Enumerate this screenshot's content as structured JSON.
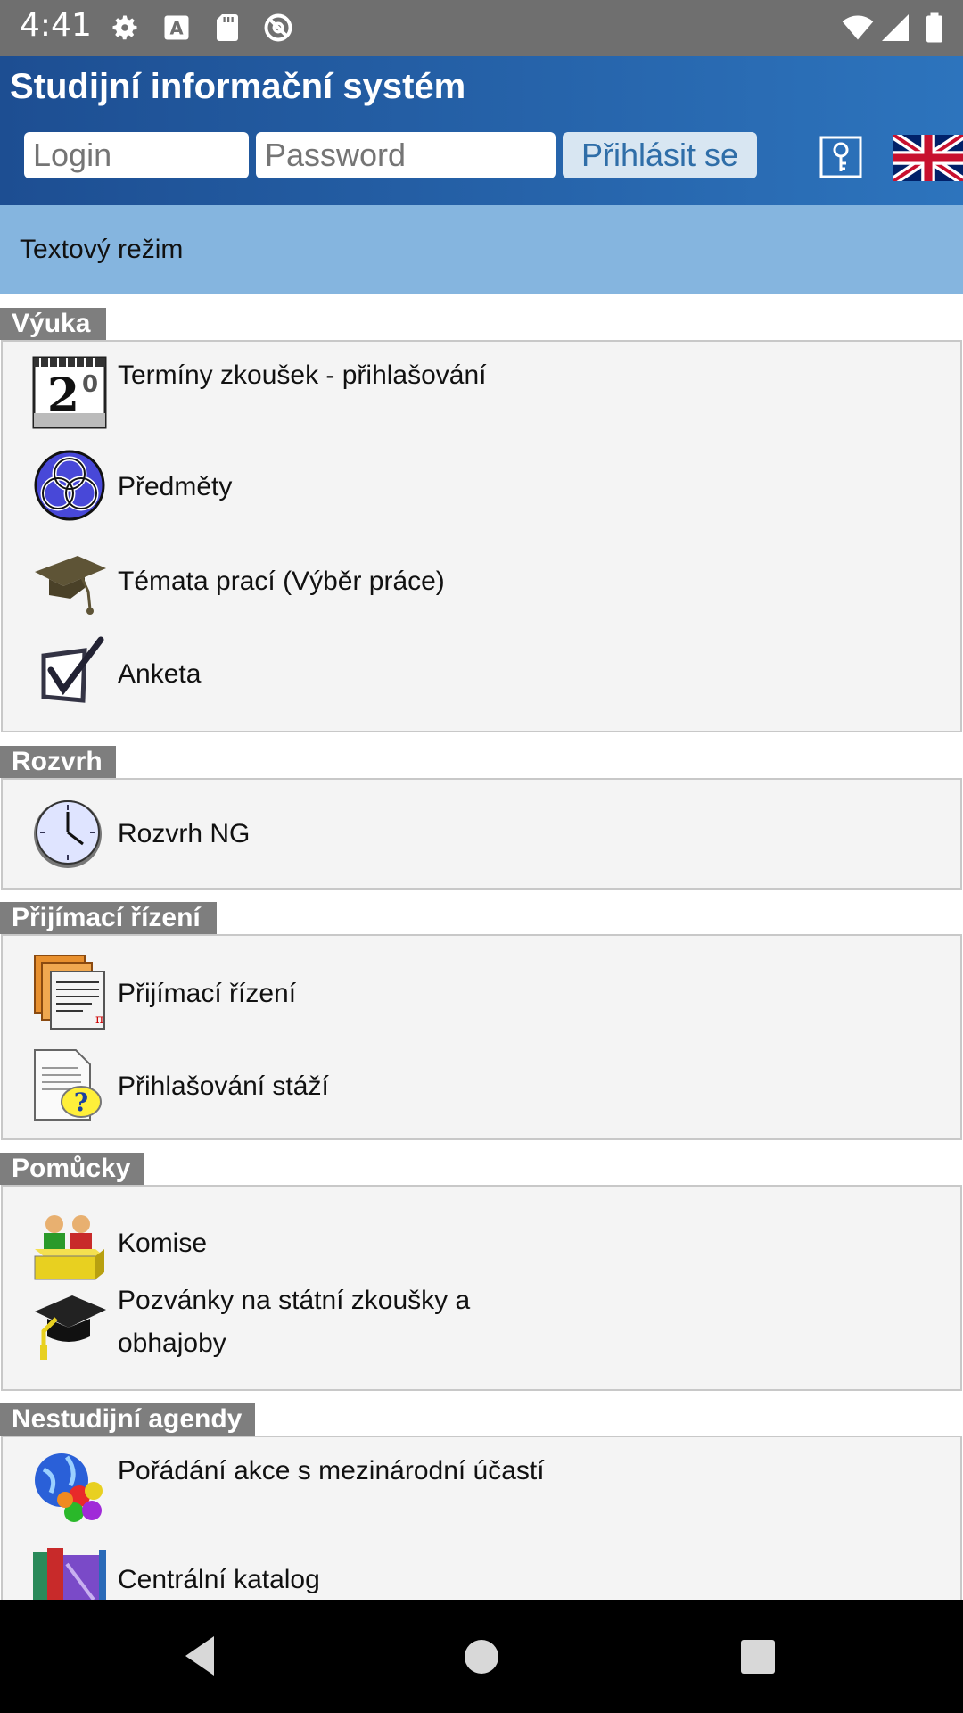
{
  "status_bar": {
    "time": "4:41",
    "left_icons": [
      "gear-icon",
      "font-a-icon",
      "sd-card-icon",
      "do-not-disturb-icon"
    ],
    "right_icons": [
      "wifi-icon",
      "cell-signal-icon",
      "battery-icon"
    ]
  },
  "header": {
    "title": "Studijní informační systém",
    "login_placeholder": "Login",
    "password_placeholder": "Password",
    "login_button": "Přihlásit se",
    "key_icon": "key-icon",
    "language_flag": "uk-flag-icon"
  },
  "text_mode": "Textový režim",
  "sections": [
    {
      "label": "Výuka",
      "items": [
        {
          "label": "Termíny zkoušek - přihlašování",
          "icon": "calendar-icon"
        },
        {
          "label": "Předměty",
          "icon": "knot-icon"
        },
        {
          "label": "Témata prací (Výběr práce)",
          "icon": "graduation-cap-icon"
        },
        {
          "label": "Anketa",
          "icon": "checkbox-icon"
        }
      ]
    },
    {
      "label": "Rozvrh",
      "items": [
        {
          "label": "Rozvrh NG",
          "icon": "clock-icon"
        }
      ]
    },
    {
      "label": "Přijímací řízení",
      "items": [
        {
          "label": "Přijímací řízení",
          "icon": "documents-icon"
        },
        {
          "label": "Přihlašování stáží",
          "icon": "document-question-icon"
        }
      ]
    },
    {
      "label": "Pomůcky",
      "items": [
        {
          "label": "Komise",
          "icon": "committee-icon"
        },
        {
          "label": "Pozvánky na státní zkoušky a obhajoby",
          "icon": "mortarboard-icon"
        }
      ]
    },
    {
      "label": "Nestudijní agendy",
      "items": [
        {
          "label": "Pořádání akce s mezinárodní účastí",
          "icon": "globe-icon"
        },
        {
          "label": "Centrální katalog",
          "icon": "books-icon"
        }
      ]
    }
  ],
  "nav_bar": {
    "back": "back-icon",
    "home": "home-icon",
    "recents": "recents-icon"
  }
}
